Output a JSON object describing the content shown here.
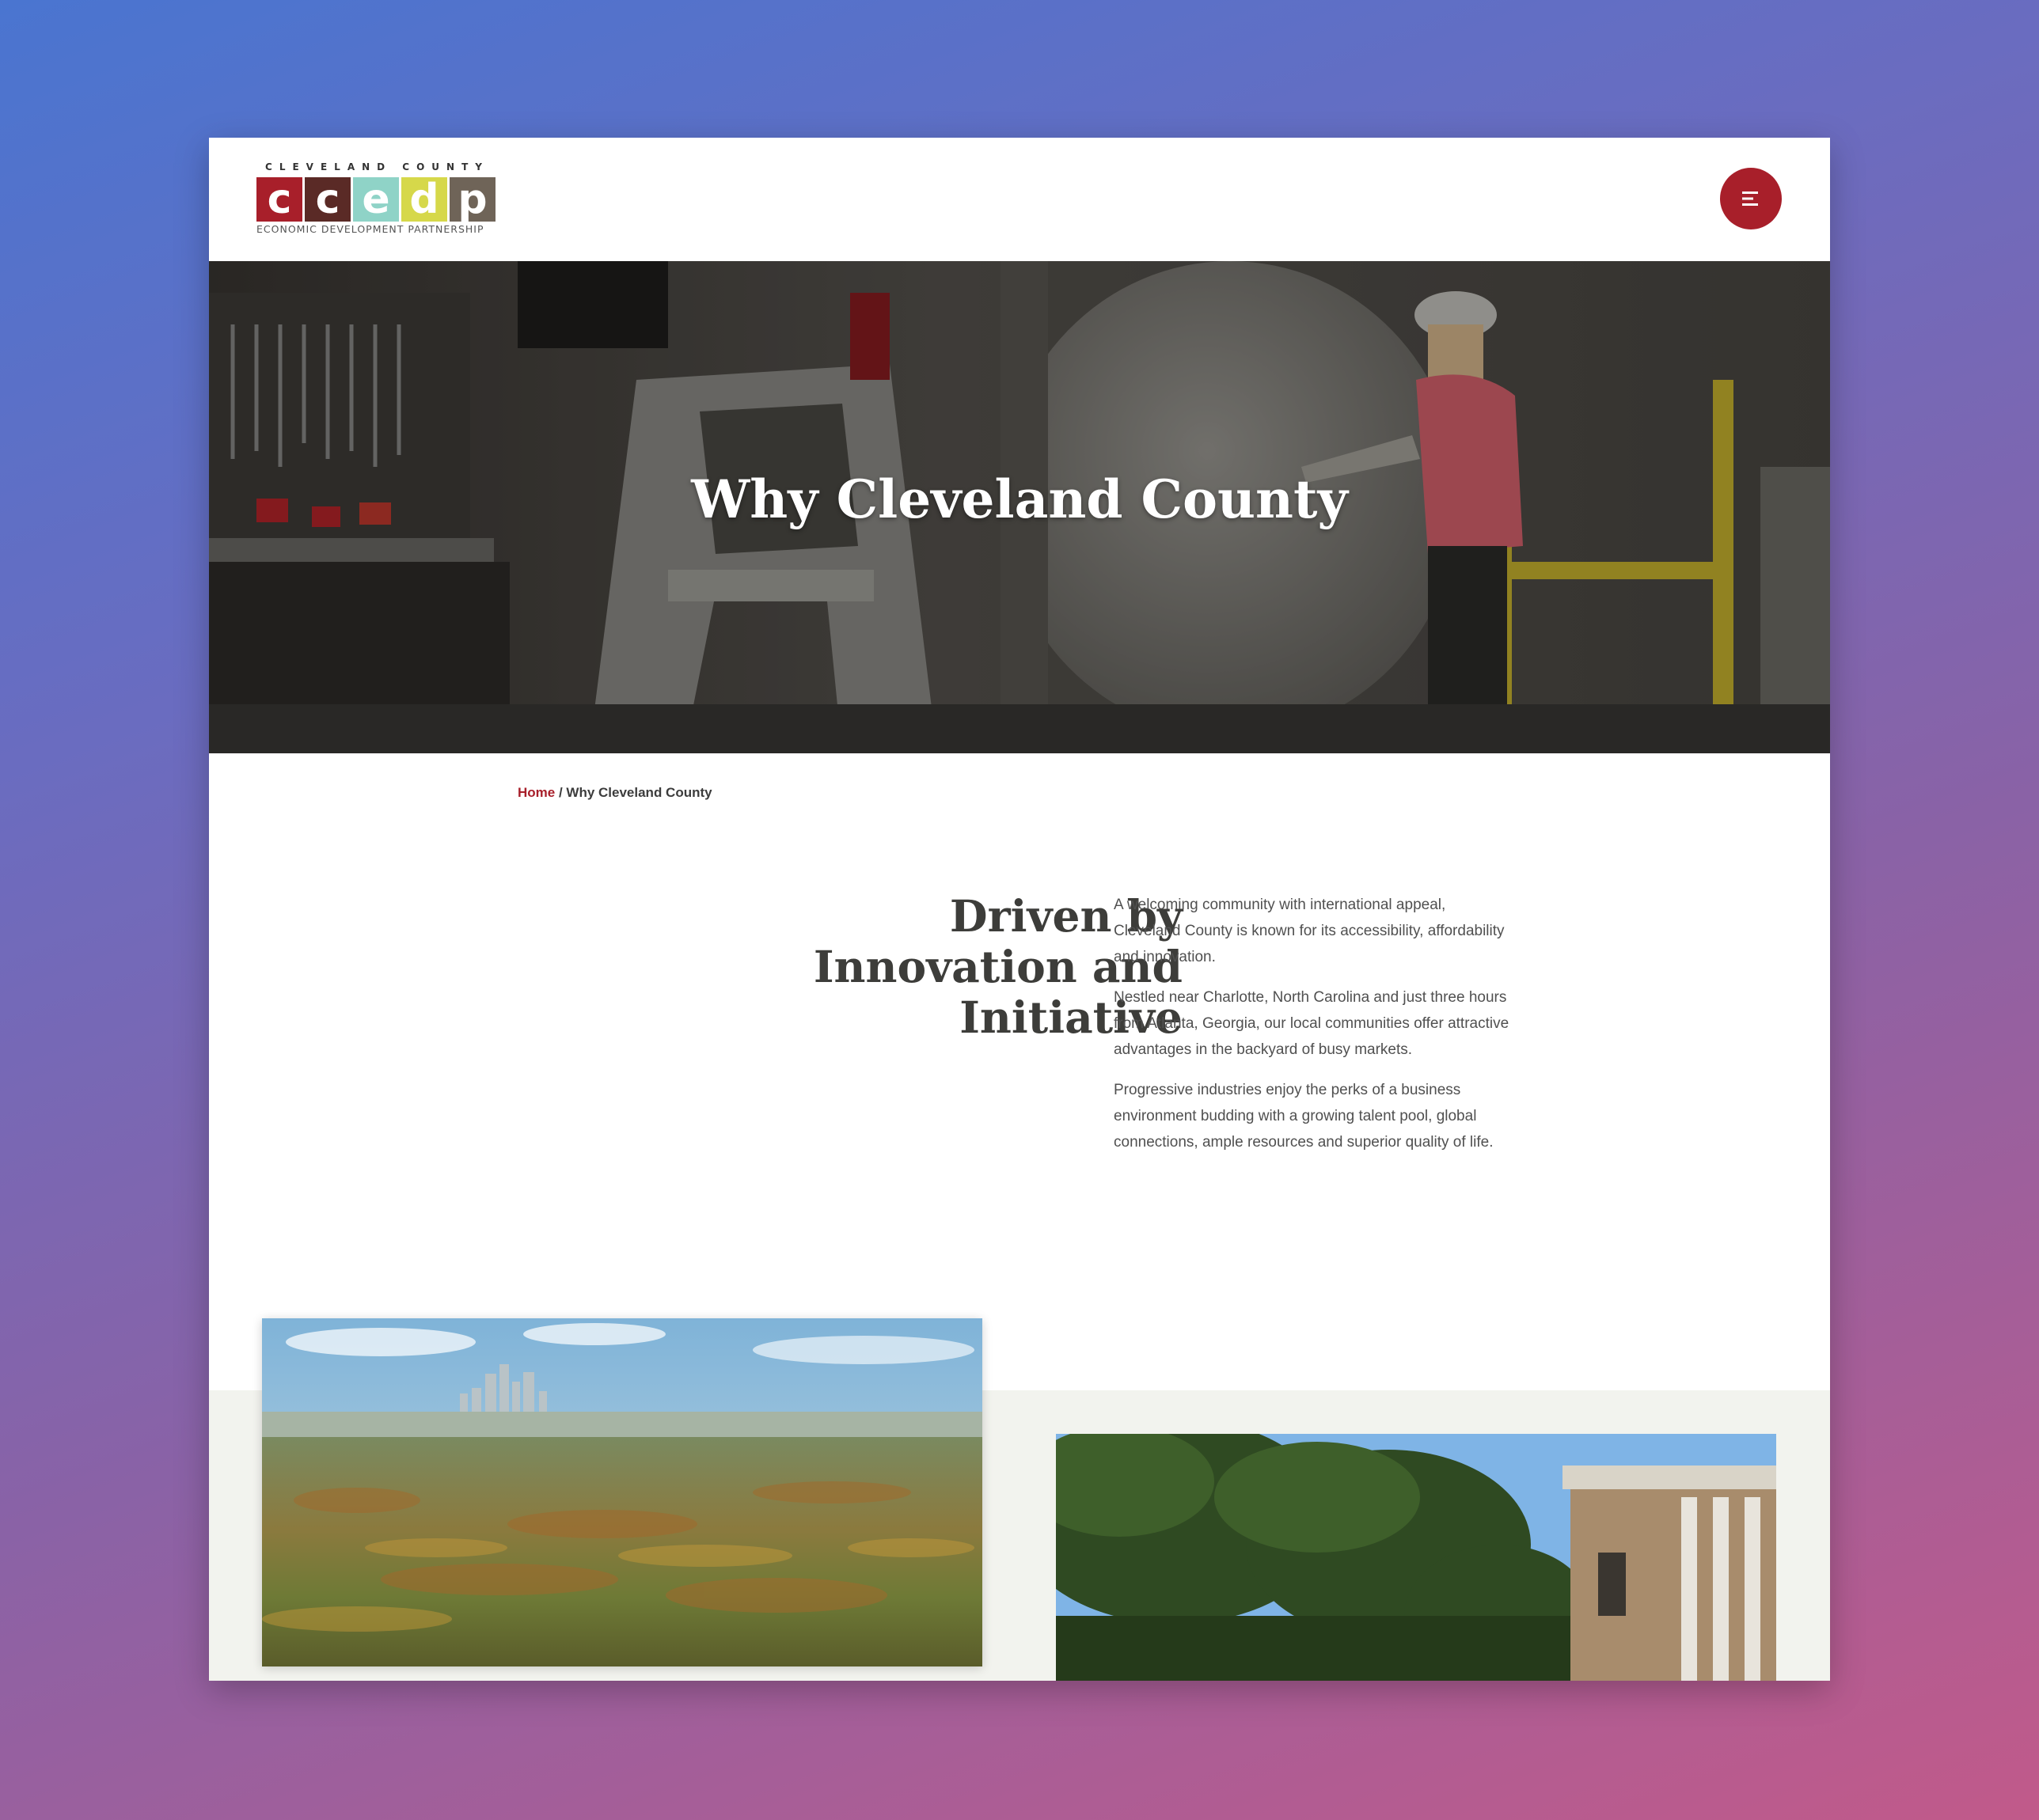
{
  "logo": {
    "top_text": "CLEVELAND COUNTY",
    "letters": [
      "c",
      "c",
      "e",
      "d",
      "p"
    ],
    "tile_colors": [
      "#a81f2a",
      "#5a2a26",
      "#8fd3c7",
      "#d6d84a",
      "#6f6458"
    ],
    "bottom_text": "ECONOMIC DEVELOPMENT PARTNERSHIP"
  },
  "header": {
    "menu_icon": "hamburger-menu-icon",
    "accent_color": "#a81f2a"
  },
  "hero": {
    "title": "Why Cleveland County"
  },
  "breadcrumb": {
    "home": "Home",
    "separator": " / ",
    "current": "Why Cleveland County"
  },
  "intro": {
    "heading_lines": [
      "Driven by",
      "Innovation and",
      "Initiative"
    ],
    "paragraphs": [
      "A welcoming community with international appeal, Cleveland County is known for its accessibility, affordability and innovation.",
      "Nestled near Charlotte, North Carolina and just three hours from Atlanta, Georgia, our local communities offer attractive advantages in the backyard of busy markets.",
      "Progressive industries enjoy the perks of a business environment budding with a growing talent pool, global connections, ample resources and superior quality of life."
    ]
  }
}
